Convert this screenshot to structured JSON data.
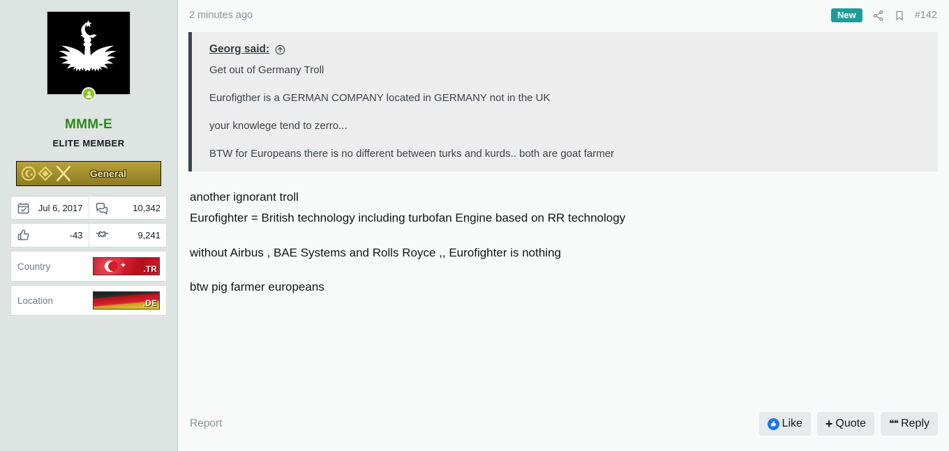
{
  "colors": {
    "sidebar_bg": "#dde4e1",
    "main_bg": "#f8f9f9",
    "username": "#2a8a1e",
    "new_badge": "#1f9b9b",
    "quote_bg": "#ededed",
    "quote_border": "#37474f",
    "like_icon": "#1778f2",
    "rank_badge": "#a48f2f"
  },
  "sidebar": {
    "avatar": {
      "alt": "double-headed-eagle-crescent-star",
      "online_status": "online"
    },
    "username": "MMM-E",
    "user_title": "ELITE MEMBER",
    "rank": {
      "label": "General",
      "icons": [
        "crescent-star-medal",
        "diamond-medal",
        "crossed-swords"
      ]
    },
    "stats": [
      {
        "left": {
          "icon": "calendar-check-icon",
          "label": "joined-date",
          "value": "Jul 6, 2017"
        },
        "right": {
          "icon": "messages-icon",
          "label": "message-count",
          "value": "10,342"
        }
      },
      {
        "left": {
          "icon": "thumbs-up-icon",
          "label": "reaction-score",
          "value": "-43"
        },
        "right": {
          "icon": "handshake-icon",
          "label": "points",
          "value": "9,241"
        }
      }
    ],
    "info": [
      {
        "label": "Country",
        "flag": "turkey-flag",
        "code": ".TR"
      },
      {
        "label": "Location",
        "flag": "germany-flag",
        "code": ".DE"
      }
    ]
  },
  "header": {
    "timestamp": "2 minutes ago",
    "new_badge": "New",
    "share_icon": "share-icon",
    "bookmark_icon": "bookmark-icon",
    "post_number": "#142"
  },
  "quote": {
    "author": "Georg said:",
    "jump_icon": "jump-to-post-icon",
    "lines": [
      "Get out of Germany Troll",
      "Eurofigther is a GERMAN COMPANY located in GERMANY not in the UK",
      "your knowlege tend to zerro...",
      "BTW for Europeans there is no different between turks and kurds.. both are goat farmer"
    ]
  },
  "body": {
    "paragraph1": [
      "another ignorant troll",
      "Eurofighter = British technology including turbofan Engine based on RR technology"
    ],
    "paragraph2": "without Airbus , BAE Systems and Rolls Royce ,, Eurofighter is nothing",
    "paragraph3": "btw pig farmer europeans"
  },
  "footer": {
    "report": "Report",
    "like": "Like",
    "quote": "Quote",
    "reply": "Reply"
  }
}
